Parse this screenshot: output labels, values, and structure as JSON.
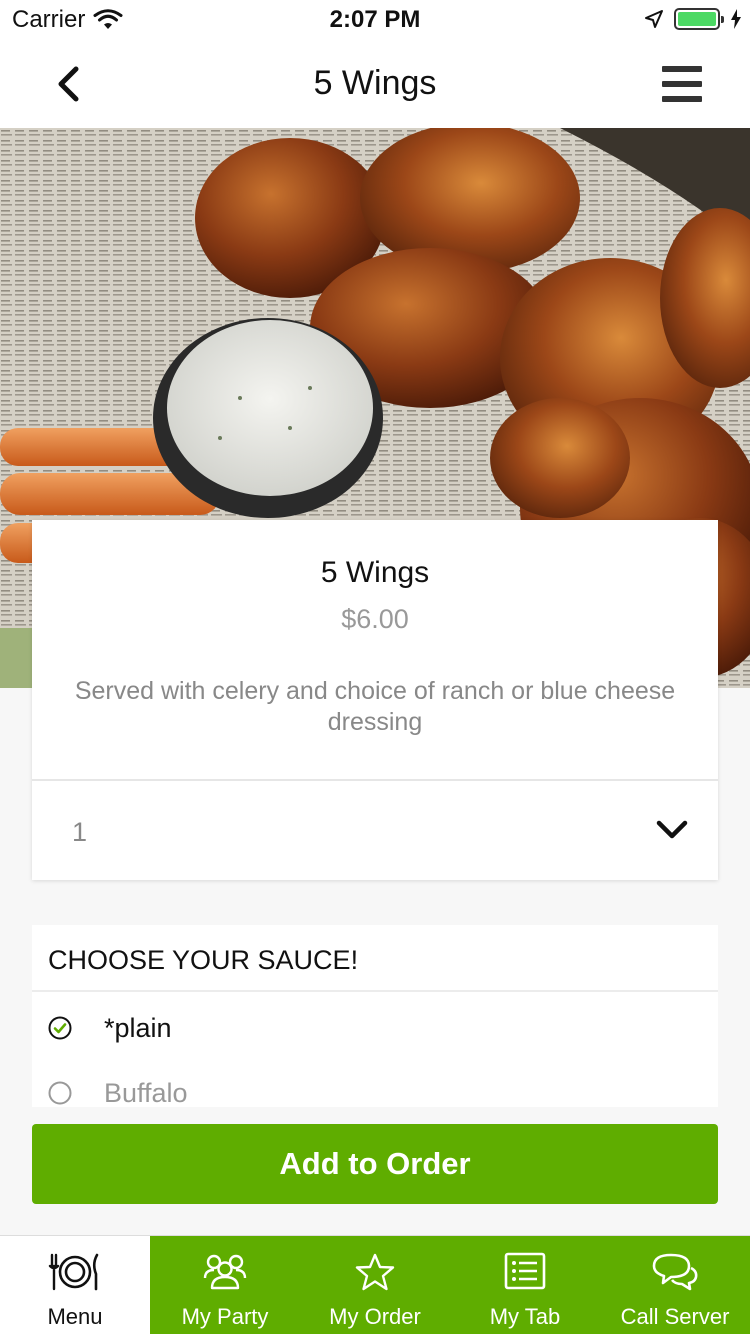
{
  "status_bar": {
    "carrier": "Carrier",
    "time": "2:07 PM"
  },
  "nav": {
    "title": "5 Wings",
    "back_icon": "chevron-left-icon",
    "menu_icon": "hamburger-icon"
  },
  "item": {
    "name": "5 Wings",
    "price": "$6.00",
    "description": "Served with celery and choice of ranch or blue cheese dressing",
    "quantity": "1"
  },
  "sauce": {
    "header": "CHOOSE YOUR SAUCE!",
    "options": [
      {
        "label": "*plain",
        "selected": true
      },
      {
        "label": "Buffalo",
        "selected": false
      }
    ]
  },
  "add_button": {
    "label": "Add to Order"
  },
  "tabs": [
    {
      "label": "Menu",
      "icon": "plate-fork-knife-icon",
      "active": true
    },
    {
      "label": "My Party",
      "icon": "group-icon",
      "active": false
    },
    {
      "label": "My Order",
      "icon": "star-icon",
      "active": false
    },
    {
      "label": "My Tab",
      "icon": "list-icon",
      "active": false
    },
    {
      "label": "Call Server",
      "icon": "chat-bubbles-icon",
      "active": false
    }
  ],
  "colors": {
    "accent": "#5fad00",
    "battery": "#4cd964",
    "muted_text": "#888888"
  }
}
